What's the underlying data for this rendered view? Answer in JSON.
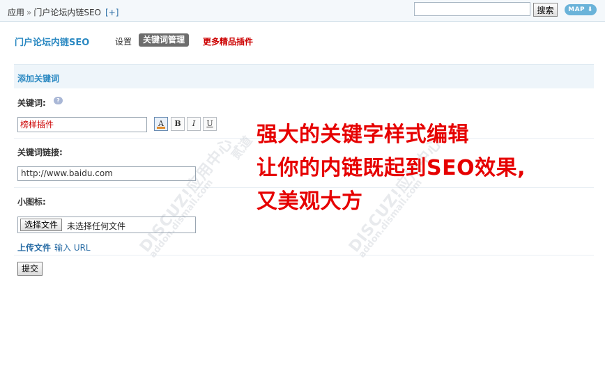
{
  "topbar": {
    "breadcrumb": {
      "root": "应用",
      "separator": "»",
      "current": "门户论坛内链SEO",
      "add": "[+]"
    },
    "search": {
      "value": "",
      "placeholder": "",
      "button_label": "搜索"
    },
    "map_button": "MAP"
  },
  "plugin": {
    "title": "门户论坛内链SEO",
    "nav": {
      "settings": "设置",
      "keyword_manage": "关键词管理",
      "more_plugins": "更多精品插件"
    }
  },
  "form": {
    "section_title": "添加关键词",
    "keyword": {
      "label": "关键词:",
      "value": "榜样插件",
      "format_buttons": [
        {
          "name": "text-color",
          "label": "A"
        },
        {
          "name": "bold",
          "label": "B"
        },
        {
          "name": "italic",
          "label": "I"
        },
        {
          "name": "underline",
          "label": "U"
        }
      ]
    },
    "link": {
      "label": "关键词链接:",
      "value": "http://www.baidu.com"
    },
    "icon": {
      "label": "小图标:",
      "file_button": "选择文件",
      "file_status": "未选择任何文件",
      "upload_link": "上传文件",
      "input_url_link": "输入 URL"
    },
    "submit_label": "提交"
  },
  "promo": {
    "line1": "强大的关键字样式编辑",
    "line2": "让你的内链既起到SEO效果,",
    "line3": "又美观大方"
  },
  "watermark": {
    "logo": "DISCUZ!应用中心",
    "site": "addon.dismall.com",
    "tag": "贰道"
  },
  "colors": {
    "accent": "#2b89c2",
    "link": "#2b6ea6",
    "promo_red": "#e60000",
    "nav_active_bg": "#6d6d6d"
  }
}
